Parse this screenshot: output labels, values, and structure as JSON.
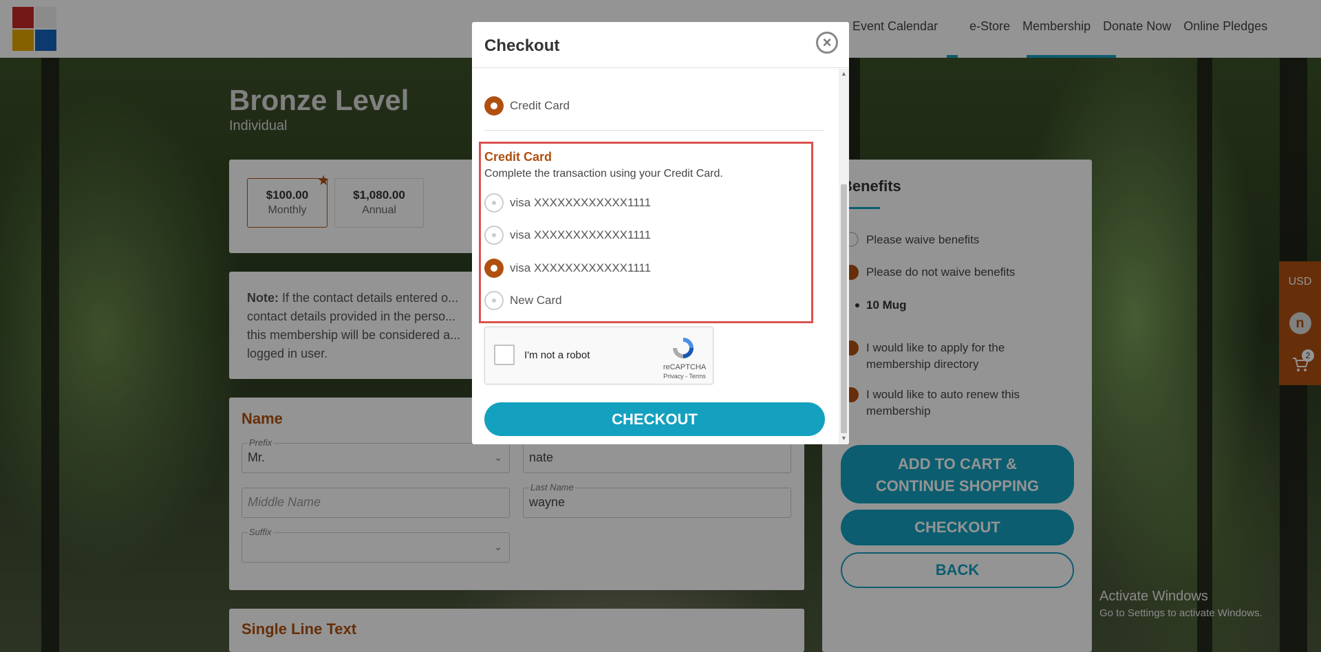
{
  "nav": {
    "links": [
      "Event Calendar",
      "e-Store",
      "Membership",
      "Donate Now",
      "Online Pledges"
    ]
  },
  "logo": {
    "colors": [
      "#c62828",
      "#f0f0f0",
      "#e6a800",
      "#1565c0"
    ]
  },
  "page": {
    "title": "Bronze Level",
    "subtitle": "Individual",
    "prices": [
      {
        "amount": "$100.00",
        "period": "Monthly"
      },
      {
        "amount": "$1,080.00",
        "period": "Annual"
      }
    ],
    "note_bold": "Note:",
    "note_text": "If the contact details entered o... contact details provided in the perso... this membership will be considered a... logged in user.",
    "name_section": "Name",
    "prefix_label": "Prefix",
    "prefix_value": "Mr.",
    "first_name_value": "nate",
    "middle_name_placeholder": "Middle Name",
    "last_name_label": "Last Name",
    "last_name_value": "wayne",
    "suffix_label": "Suffix",
    "single_line_section": "Single Line Text"
  },
  "benefits": {
    "title": "Benefits",
    "items": [
      "Please waive benefits",
      "Please do not waive benefits",
      "10 Mug",
      "I would like to apply for the membership directory",
      "I would like to auto renew this membership"
    ],
    "add_to_cart": "ADD TO CART & CONTINUE SHOPPING",
    "checkout": "CHECKOUT",
    "back": "BACK"
  },
  "side": {
    "currency": "USD",
    "avatar": "n",
    "cart_count": "2"
  },
  "activate": {
    "line1": "Activate Windows",
    "line2": "Go to Settings to activate Windows."
  },
  "modal": {
    "title": "Checkout",
    "payment_method": "Credit Card",
    "cc_title": "Credit Card",
    "cc_desc": "Complete the transaction using your Credit Card.",
    "cards": [
      {
        "label": "visa XXXXXXXXXXXX1111",
        "selected": false
      },
      {
        "label": "visa XXXXXXXXXXXX1111",
        "selected": false
      },
      {
        "label": "visa XXXXXXXXXXXX1111",
        "selected": true
      },
      {
        "label": "New Card",
        "selected": false
      }
    ],
    "captcha_text": "I'm not a robot",
    "captcha_brand": "reCAPTCHA",
    "captcha_links": "Privacy - Terms",
    "checkout_button": "CHECKOUT"
  },
  "colors": {
    "accent": "#14a0bf",
    "brand": "#b05010",
    "highlight": "#d9534f"
  }
}
